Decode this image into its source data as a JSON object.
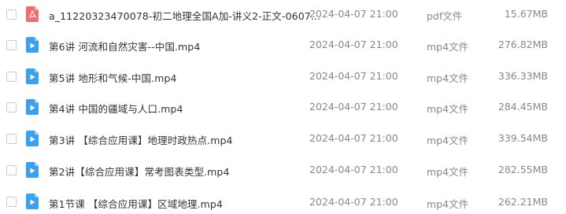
{
  "colors": {
    "pdf_icon": "#f26d6d",
    "video_icon": "#3aa0f0",
    "text_primary": "#333333",
    "text_secondary": "#888888"
  },
  "files": [
    {
      "icon": "pdf-icon",
      "name": "a_11220323470078-初二地理全国A加-讲义2-正文-0607...",
      "date": "2024-04-07 21:00",
      "type": "pdf文件",
      "size": "15.67MB"
    },
    {
      "icon": "video-icon",
      "name": "第6讲 河流和自然灾害--中国.mp4",
      "date": "2024-04-07 21:00",
      "type": "mp4文件",
      "size": "276.82MB"
    },
    {
      "icon": "video-icon",
      "name": "第5讲 地形和气候-中国.mp4",
      "date": "2024-04-07 21:00",
      "type": "mp4文件",
      "size": "336.33MB"
    },
    {
      "icon": "video-icon",
      "name": "第4讲 中国的疆域与人口.mp4",
      "date": "2024-04-07 21:00",
      "type": "mp4文件",
      "size": "284.45MB"
    },
    {
      "icon": "video-icon",
      "name": "第3讲 【综合应用课】地理时政热点.mp4",
      "date": "2024-04-07 21:00",
      "type": "mp4文件",
      "size": "339.54MB"
    },
    {
      "icon": "video-icon",
      "name": "第2讲【综合应用课】常考图表类型.mp4",
      "date": "2024-04-07 21:00",
      "type": "mp4文件",
      "size": "282.55MB"
    },
    {
      "icon": "video-icon",
      "name": "第1节课 【综合应用课】区域地理.mp4",
      "date": "2024-04-07 21:00",
      "type": "mp4文件",
      "size": "262.21MB"
    }
  ]
}
